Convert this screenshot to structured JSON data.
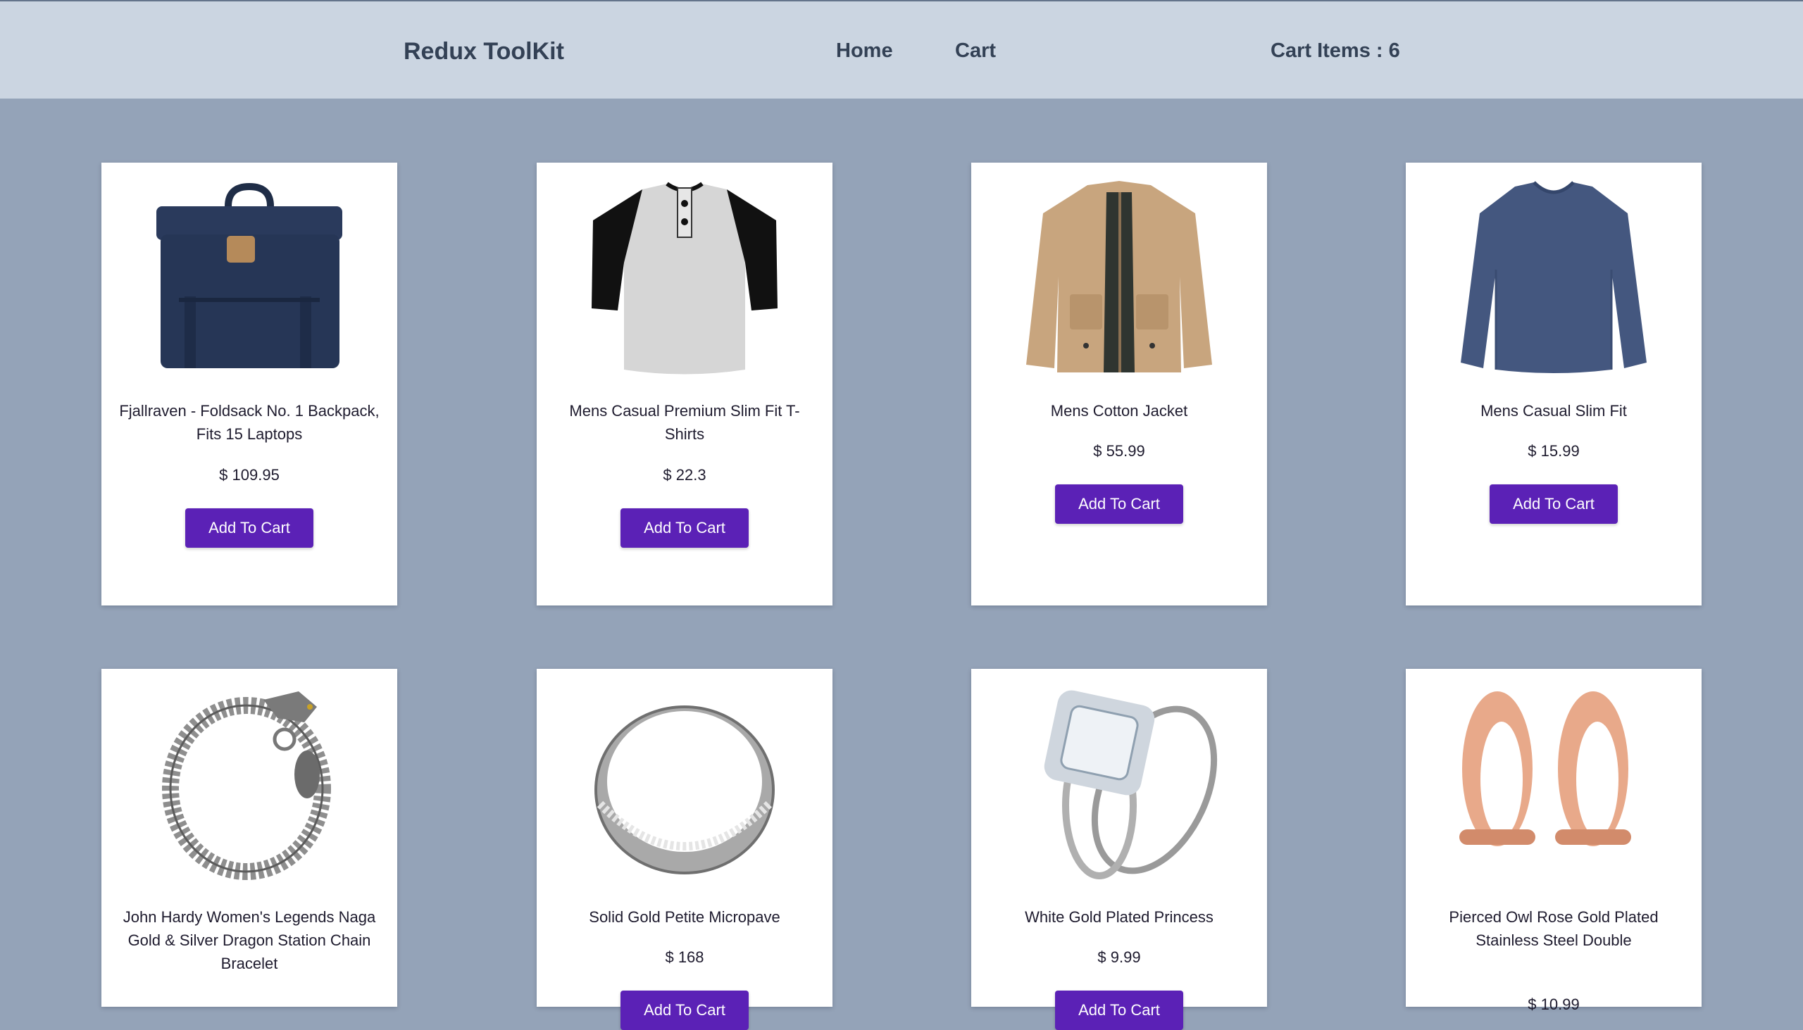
{
  "header": {
    "brand": "Redux ToolKit",
    "nav": {
      "home": "Home",
      "cart": "Cart"
    },
    "cart_items": "Cart Items : 6"
  },
  "products": [
    {
      "title": "Fjallraven - Foldsack No. 1 Backpack, Fits 15 Laptops",
      "price": "$ 109.95",
      "button": "Add To Cart"
    },
    {
      "title": "Mens Casual Premium Slim Fit T-Shirts",
      "price": "$ 22.3",
      "button": "Add To Cart"
    },
    {
      "title": "Mens Cotton Jacket",
      "price": "$ 55.99",
      "button": "Add To Cart"
    },
    {
      "title": "Mens Casual Slim Fit",
      "price": "$ 15.99",
      "button": "Add To Cart"
    },
    {
      "title": "John Hardy Women's Legends Naga Gold & Silver Dragon Station Chain Bracelet",
      "price": "",
      "button": ""
    },
    {
      "title": "Solid Gold Petite Micropave",
      "price": "$ 168",
      "button": "Add To Cart"
    },
    {
      "title": "White Gold Plated Princess",
      "price": "$ 9.99",
      "button": "Add To Cart"
    },
    {
      "title": "Pierced Owl Rose Gold Plated Stainless Steel Double",
      "price": "$ 10.99",
      "button": ""
    }
  ],
  "colors": {
    "page_bg": "#94a3b8",
    "header_bg": "#cbd5e1",
    "button_bg": "#5b21b6"
  }
}
